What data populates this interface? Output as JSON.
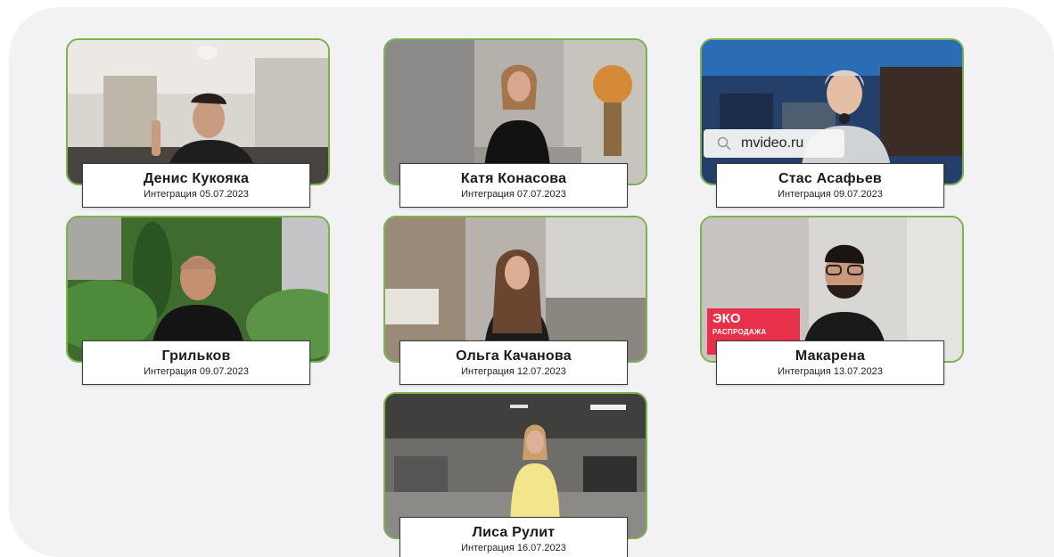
{
  "cards": [
    {
      "name": "Денис Кукояка",
      "date": "Интеграция 05.07.2023"
    },
    {
      "name": "Катя Конасова",
      "date": "Интеграция 07.07.2023"
    },
    {
      "name": "Стас Асафьев",
      "date": "Интеграция 09.07.2023"
    },
    {
      "name": "Грильков",
      "date": "Интеграция 09.07.2023"
    },
    {
      "name": "Ольга Качанова",
      "date": "Интеграция 12.07.2023"
    },
    {
      "name": "Макарена",
      "date": "Интеграция 13.07.2023"
    },
    {
      "name": "Лиса Рулит",
      "date": "Интеграция 16.07.2023"
    }
  ],
  "overlays": {
    "search_text": "mvideo.ru",
    "promo_line1": "ЭКО",
    "promo_line2": "РАСПРОДАЖА"
  },
  "colors": {
    "frame_border": "#7bb24b",
    "panel_bg": "#f2f2f4"
  }
}
